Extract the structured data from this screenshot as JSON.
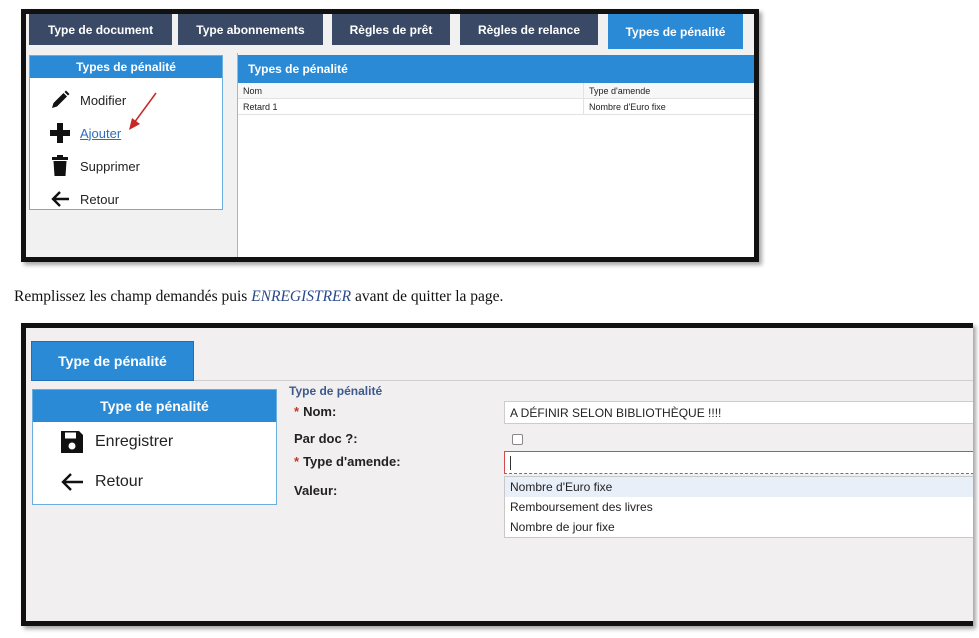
{
  "screen1": {
    "tabs": [
      {
        "label": "Type de document"
      },
      {
        "label": "Type abonnements"
      },
      {
        "label": "Règles de prêt"
      },
      {
        "label": "Règles de relance"
      },
      {
        "label": "Types de pénalité"
      }
    ],
    "active_tab": "Types de pénalité",
    "sidebar": {
      "title": "Types de pénalité",
      "items": [
        {
          "label": "Modifier",
          "icon": "pencil-icon"
        },
        {
          "label": "Ajouter",
          "icon": "plus-icon"
        },
        {
          "label": "Supprimer",
          "icon": "trash-icon"
        },
        {
          "label": "Retour",
          "icon": "arrow-left-icon"
        }
      ]
    },
    "panel": {
      "title": "Types de pénalité",
      "columns": [
        "Nom",
        "Type d'amende"
      ],
      "rows": [
        [
          "Retard 1",
          "Nombre d'Euro fixe"
        ]
      ]
    },
    "annotation_color": "#c62828"
  },
  "instruction": {
    "before": "Remplissez les champ demandés  puis ",
    "emphasis": "ENREGISTRER",
    "after": " avant de quitter la page."
  },
  "screen2": {
    "tab": "Type de pénalité",
    "sidebar": {
      "title": "Type de pénalité",
      "items": [
        {
          "label": "Enregistrer",
          "icon": "save-icon"
        },
        {
          "label": "Retour",
          "icon": "arrow-left-icon"
        }
      ]
    },
    "form": {
      "title": "Type de pénalité",
      "required_mark": "*",
      "fields": {
        "nom": {
          "label": "Nom:",
          "value": "A DÉFINIR SELON BIBLIOTHÈQUE !!!!"
        },
        "par_doc": {
          "label": "Par doc ?:",
          "checked": false
        },
        "type_amende": {
          "label": "Type d'amende:",
          "value": "",
          "options": [
            "Nombre d'Euro fixe",
            "Remboursement des livres",
            "Nombre de jour fixe"
          ]
        },
        "valeur": {
          "label": "Valeur:"
        }
      }
    }
  },
  "colors": {
    "accent": "#2b8ad6",
    "tab_inactive": "#3a4a66",
    "required": "#c0392b"
  }
}
